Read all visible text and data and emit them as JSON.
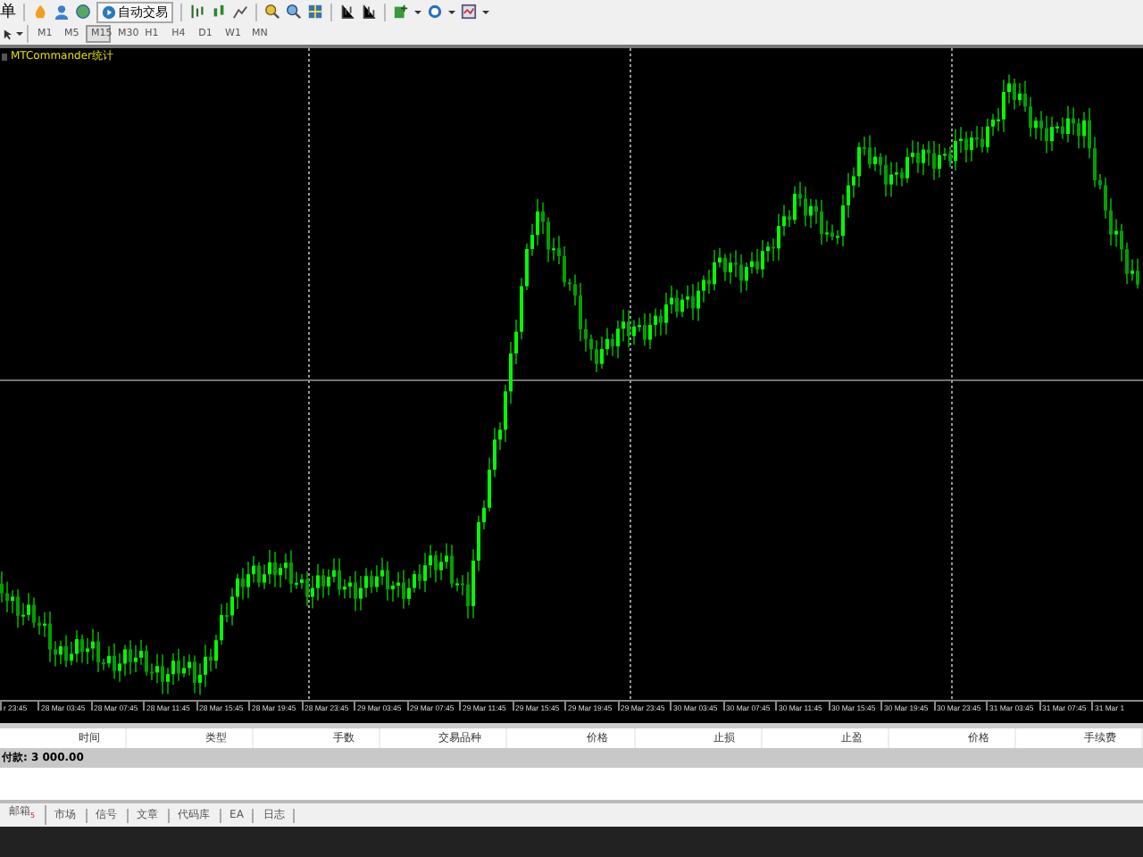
{
  "toolbar": {
    "cut_label": "单",
    "auto_trade_button": "自动交易",
    "timeframes": [
      {
        "label": "M1",
        "selected": false
      },
      {
        "label": "M5",
        "selected": false
      },
      {
        "label": "M15",
        "selected": true
      },
      {
        "label": "M30",
        "selected": false
      },
      {
        "label": "H1",
        "selected": false
      },
      {
        "label": "H4",
        "selected": false
      },
      {
        "label": "D1",
        "selected": false
      },
      {
        "label": "W1",
        "selected": false
      },
      {
        "label": "MN",
        "selected": false
      }
    ]
  },
  "chart": {
    "indicator_label": "MTCommander统计",
    "time_labels": [
      "r 23:45",
      "28 Mar 03:45",
      "28 Mar 07:45",
      "28 Mar 11:45",
      "28 Mar 15:45",
      "28 Mar 19:45",
      "28 Mar 23:45",
      "29 Mar 03:45",
      "29 Mar 07:45",
      "29 Mar 11:45",
      "29 Mar 15:45",
      "29 Mar 19:45",
      "29 Mar 23:45",
      "30 Mar 03:45",
      "30 Mar 07:45",
      "30 Mar 11:45",
      "30 Mar 15:45",
      "30 Mar 19:45",
      "30 Mar 23:45",
      "31 Mar 03:45",
      "31 Mar 07:45",
      "31 Mar 1"
    ]
  },
  "table": {
    "columns": [
      "时间",
      "类型",
      "手数",
      "交易品种",
      "价格",
      "止损",
      "止盈",
      "价格",
      "手续费"
    ],
    "balance_row": "付款: 3 000.00"
  },
  "tabs": [
    {
      "label": "邮箱",
      "badge": "5",
      "selected": false
    },
    {
      "label": "市场",
      "selected": false
    },
    {
      "label": "信号",
      "selected": false
    },
    {
      "label": "文章",
      "selected": false
    },
    {
      "label": "代码库",
      "selected": false
    },
    {
      "label": "EA",
      "selected": false
    },
    {
      "label": "日志",
      "selected": false
    }
  ]
}
